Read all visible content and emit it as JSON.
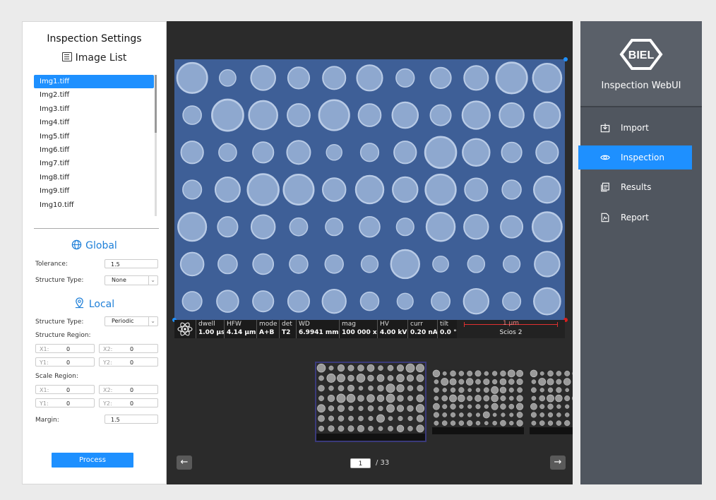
{
  "left_panel": {
    "title": "Inspection Settings",
    "image_list_heading": "Image List",
    "images": [
      "Img1.tiff",
      "Img2.tiff",
      "Img3.tiff",
      "Img4.tiff",
      "Img5.tiff",
      "Img6.tiff",
      "Img7.tiff",
      "Img8.tiff",
      "Img9.tiff",
      "Img10.tiff"
    ],
    "selected_image": "Img1.tiff",
    "global": {
      "heading": "Global",
      "tolerance_label": "Tolerance:",
      "tolerance_value": "1.5",
      "structure_type_label": "Structure Type:",
      "structure_type_value": "None"
    },
    "local": {
      "heading": "Local",
      "structure_type_label": "Structure Type:",
      "structure_type_value": "Periodic",
      "structure_region_label": "Structure Region:",
      "structure_region": {
        "x1_label": "X1:",
        "x1": "0",
        "x2_label": "X2:",
        "x2": "0",
        "y1_label": "Y1:",
        "y1": "0",
        "y2_label": "Y2:",
        "y2": "0"
      },
      "scale_region_label": "Scale Region:",
      "scale_region": {
        "x1_label": "X1:",
        "x1": "0",
        "x2_label": "X2:",
        "x2": "0",
        "y1_label": "Y1:",
        "y1": "0",
        "y2_label": "Y2:",
        "y2": "0"
      },
      "margin_label": "Margin:",
      "margin_value": "1.5"
    },
    "process_button": "Process"
  },
  "viewer": {
    "info_bar": [
      {
        "title": "dwell",
        "value": "1.00 µs"
      },
      {
        "title": "HFW",
        "value": "4.14 µm"
      },
      {
        "title": "mode",
        "value": "A+B"
      },
      {
        "title": "det",
        "value": "T2"
      },
      {
        "title": "WD",
        "value": "6.9941 mm"
      },
      {
        "title": "mag",
        "value": "100 000 x"
      },
      {
        "title": "HV",
        "value": "4.00 kV"
      },
      {
        "title": "curr",
        "value": "0.20 nA"
      },
      {
        "title": "tilt",
        "value": "0.0 °"
      }
    ],
    "scale_label": "1 µm",
    "instrument": "Scios 2",
    "page_current": "1",
    "page_total": "/ 33",
    "colors": {
      "overlay": "#3a64b4",
      "handle_blue": "#1e90ff",
      "handle_red": "#d81e1e"
    }
  },
  "right_panel": {
    "logo_text": "BIEL",
    "app_name": "Inspection WebUI",
    "nav": [
      {
        "label": "Import",
        "icon": "import-icon",
        "active": false
      },
      {
        "label": "Inspection",
        "icon": "eye-icon",
        "active": true
      },
      {
        "label": "Results",
        "icon": "results-icon",
        "active": false
      },
      {
        "label": "Report",
        "icon": "report-icon",
        "active": false
      }
    ]
  }
}
